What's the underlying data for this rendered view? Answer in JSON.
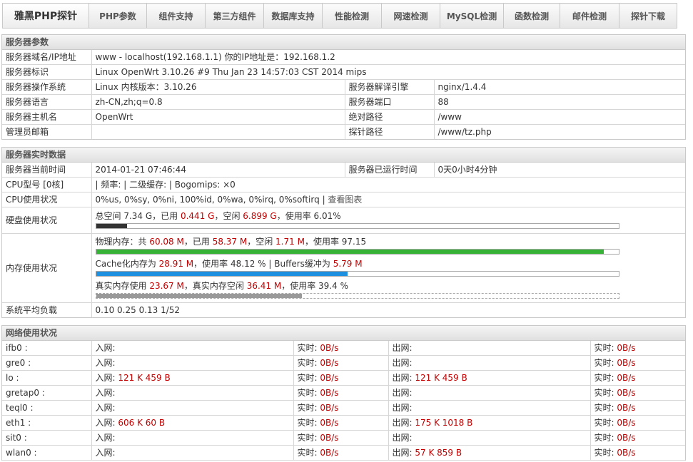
{
  "nav": {
    "brand": "雅黑PHP探针",
    "items": [
      "PHP参数",
      "组件支持",
      "第三方组件",
      "数据库支持",
      "性能检测",
      "网速检测",
      "MySQL检测",
      "函数检测",
      "邮件检测",
      "探针下载"
    ]
  },
  "server_params": {
    "title": "服务器参数",
    "rows": [
      {
        "label": "服务器域名/IP地址",
        "value": "www - localhost(192.168.1.1)  你的IP地址是：192.168.1.2"
      },
      {
        "label": "服务器标识",
        "value": "Linux OpenWrt 3.10.26 #9 Thu Jan 23 14:57:03 CST 2014 mips"
      },
      {
        "label": "服务器操作系统",
        "value": "Linux  内核版本：3.10.26",
        "label2": "服务器解译引擎",
        "value2": "nginx/1.4.4"
      },
      {
        "label": "服务器语言",
        "value": "zh-CN,zh;q=0.8",
        "label2": "服务器端口",
        "value2": "88"
      },
      {
        "label": "服务器主机名",
        "value": "OpenWrt",
        "label2": "绝对路径",
        "value2": "/www"
      },
      {
        "label": "管理员邮箱",
        "value": "",
        "label2": "探针路径",
        "value2": "/www/tz.php"
      }
    ]
  },
  "realtime": {
    "title": "服务器实时数据",
    "time_label": "服务器当前时间",
    "time_value": "2014-01-21 07:46:44",
    "uptime_label": "服务器已运行时间",
    "uptime_value": "0天0小时4分钟",
    "cpu_model_label": "CPU型号 [0核]",
    "cpu_model_value": "| 频率: | 二级缓存: | Bogomips: ×0",
    "cpu_usage_label": "CPU使用状况",
    "cpu_usage_value": "0%us, 0%sy, 0%ni, 100%id, 0%wa, 0%irq, 0%softirq",
    "cpu_chart_link": "查看图表",
    "disk_label": "硬盘使用状况",
    "disk": {
      "pre": "总空间 7.34 G，已用 ",
      "used": "0.441 G",
      "mid": "，空闲 ",
      "free": "6.899 G",
      "post": "，使用率 6.01%",
      "percent": 6.01
    },
    "mem_label": "内存使用状况",
    "mem_physical": {
      "pre": "物理内存：共 ",
      "total": "60.08 M",
      "a": "，已用 ",
      "used": "58.37 M",
      "b": "，空闲 ",
      "free": "1.71 M",
      "c": "，使用率 97.15",
      "percent": 97.15
    },
    "mem_cache": {
      "pre": "Cache化内存为 ",
      "cache": "28.91 M",
      "a": "，使用率 48.12 % | Buffers缓冲为 ",
      "buffers": "5.79 M",
      "percent": 48.12
    },
    "mem_real": {
      "pre": "真实内存使用 ",
      "used": "23.67 M",
      "a": "，真实内存空闲 ",
      "free": "36.41 M",
      "b": "，使用率 39.4 %",
      "percent": 39.4
    },
    "load_label": "系统平均负载",
    "load_value": "0.10 0.25 0.13 1/52"
  },
  "colors": {
    "disk_bar": "#333333",
    "physical_bar": "#36b336",
    "cache_bar": "#1e90e0",
    "real_bar": "#999999"
  },
  "network": {
    "title": "网络使用状况",
    "in_label": "入网:",
    "out_label": "出网:",
    "rt_label": "实时:",
    "rows": [
      {
        "name": "ifb0 :",
        "in": "",
        "in_rt": "0B/s",
        "out": "",
        "out_rt": "0B/s"
      },
      {
        "name": "gre0 :",
        "in": "",
        "in_rt": "0B/s",
        "out": "",
        "out_rt": "0B/s"
      },
      {
        "name": "lo :",
        "in": "121 K 459 B",
        "in_rt": "0B/s",
        "out": "121 K 459 B",
        "out_rt": "0B/s"
      },
      {
        "name": "gretap0 :",
        "in": "",
        "in_rt": "0B/s",
        "out": "",
        "out_rt": "0B/s"
      },
      {
        "name": "teql0 :",
        "in": "",
        "in_rt": "0B/s",
        "out": "",
        "out_rt": "0B/s"
      },
      {
        "name": "eth1 :",
        "in": "606 K 60 B",
        "in_rt": "0B/s",
        "out": "175 K 1018 B",
        "out_rt": "0B/s"
      },
      {
        "name": "sit0 :",
        "in": "",
        "in_rt": "0B/s",
        "out": "",
        "out_rt": "0B/s"
      },
      {
        "name": "wlan0 :",
        "in": "",
        "in_rt": "0B/s",
        "out": "57 K 859 B",
        "out_rt": "0B/s"
      }
    ]
  }
}
